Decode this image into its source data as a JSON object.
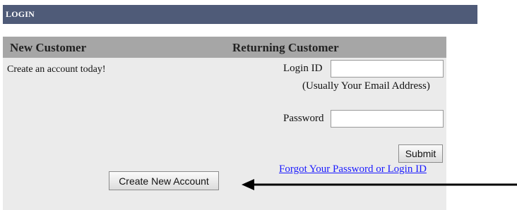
{
  "login_bar": {
    "title": "LOGIN"
  },
  "panel": {
    "new_customer_header": "New Customer",
    "returning_customer_header": "Returning Customer",
    "create_account_text": "Create an account today!",
    "login_id_label": "Login ID",
    "login_id_value": "",
    "login_id_hint": "(Usually Your Email Address)",
    "password_label": "Password",
    "password_value": "",
    "submit_label": "Submit",
    "forgot_link_label": "Forgot Your Password or Login ID",
    "create_account_button_label": "Create New Account"
  },
  "annotation": {
    "arrow_icon": "left-arrow-icon",
    "arrow_color": "#000000"
  },
  "colors": {
    "login_bar_bg": "#4f5b78",
    "panel_bg": "#ebebeb",
    "header_bg": "#a6a6a6",
    "link_color": "#1a1aff"
  }
}
